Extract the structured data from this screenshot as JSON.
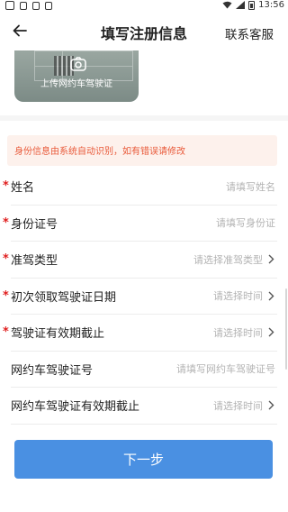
{
  "status_bar": {
    "time": "13:56",
    "left_icons": [
      "app-icon",
      "notification-icon",
      "notification-icon",
      "notification-icon"
    ],
    "right_icons": [
      "wifi-icon",
      "signal-icon",
      "battery-icon"
    ]
  },
  "header": {
    "title": "填写注册信息",
    "right_action": "联系客服",
    "back_icon": "back-arrow-icon"
  },
  "upload": {
    "label": "上传网约车驾驶证",
    "icon": "camera-icon"
  },
  "notice": {
    "text": "身份信息由系统自动识别，如有错误请修改"
  },
  "fields": [
    {
      "label": "姓名",
      "required": true,
      "placeholder": "请填写姓名",
      "chevron": false
    },
    {
      "label": "身份证号",
      "required": true,
      "placeholder": "请填写身份证",
      "chevron": false
    },
    {
      "label": "准驾类型",
      "required": true,
      "placeholder": "请选择准驾类型",
      "chevron": true
    },
    {
      "label": "初次领取驾驶证日期",
      "required": true,
      "placeholder": "请选择时间",
      "chevron": true
    },
    {
      "label": "驾驶证有效期截止",
      "required": true,
      "placeholder": "请选择时间",
      "chevron": true
    },
    {
      "label": "网约车驾驶证号",
      "required": false,
      "placeholder": "请填写网约车驾驶证号",
      "chevron": false
    },
    {
      "label": "网约车驾驶证有效期截止",
      "required": false,
      "placeholder": "请选择时间",
      "chevron": true
    }
  ],
  "actions": {
    "next_label": "下一步"
  },
  "colors": {
    "primary": "#4a90e2",
    "required": "#e02020",
    "notice_text": "#e95a3a",
    "notice_bg": "#fdf1ec",
    "placeholder": "#b3b3b3"
  }
}
